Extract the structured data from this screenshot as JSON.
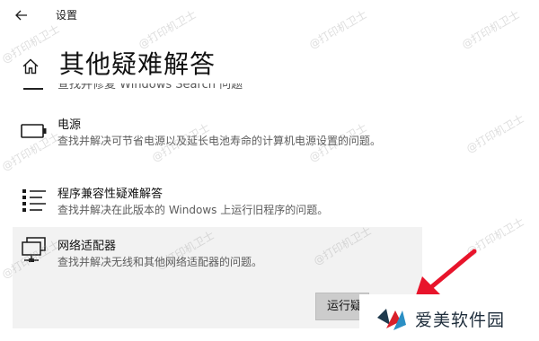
{
  "window": {
    "title": "设置",
    "back_icon": "back-arrow-icon"
  },
  "page": {
    "home_icon": "home-icon",
    "title": "其他疑难解答",
    "cut_off_text": "查找并修复 Windows Search 问题"
  },
  "troubleshooters": [
    {
      "icon": "battery-icon",
      "name": "电源",
      "description": "查找并解决可节省电源以及延长电池寿命的计算机电源设置的问题。"
    },
    {
      "icon": "program-list-icon",
      "name": "程序兼容性疑难解答",
      "description": "查找并解决在此版本的 Windows 上运行旧程序的问题。"
    },
    {
      "icon": "network-adapter-icon",
      "name": "网络适配器",
      "description": "查找并解决无线和其他网络适配器的问题。",
      "selected": true,
      "run_button": "运行疑难解答"
    }
  ],
  "overlay": {
    "watermark": "@打印机卫士",
    "arrow_color": "#e8142b",
    "brand_text": "爱美软件园",
    "brand_logo_icon": "brand-logo-icon",
    "arrow_icon": "red-arrow-icon"
  }
}
